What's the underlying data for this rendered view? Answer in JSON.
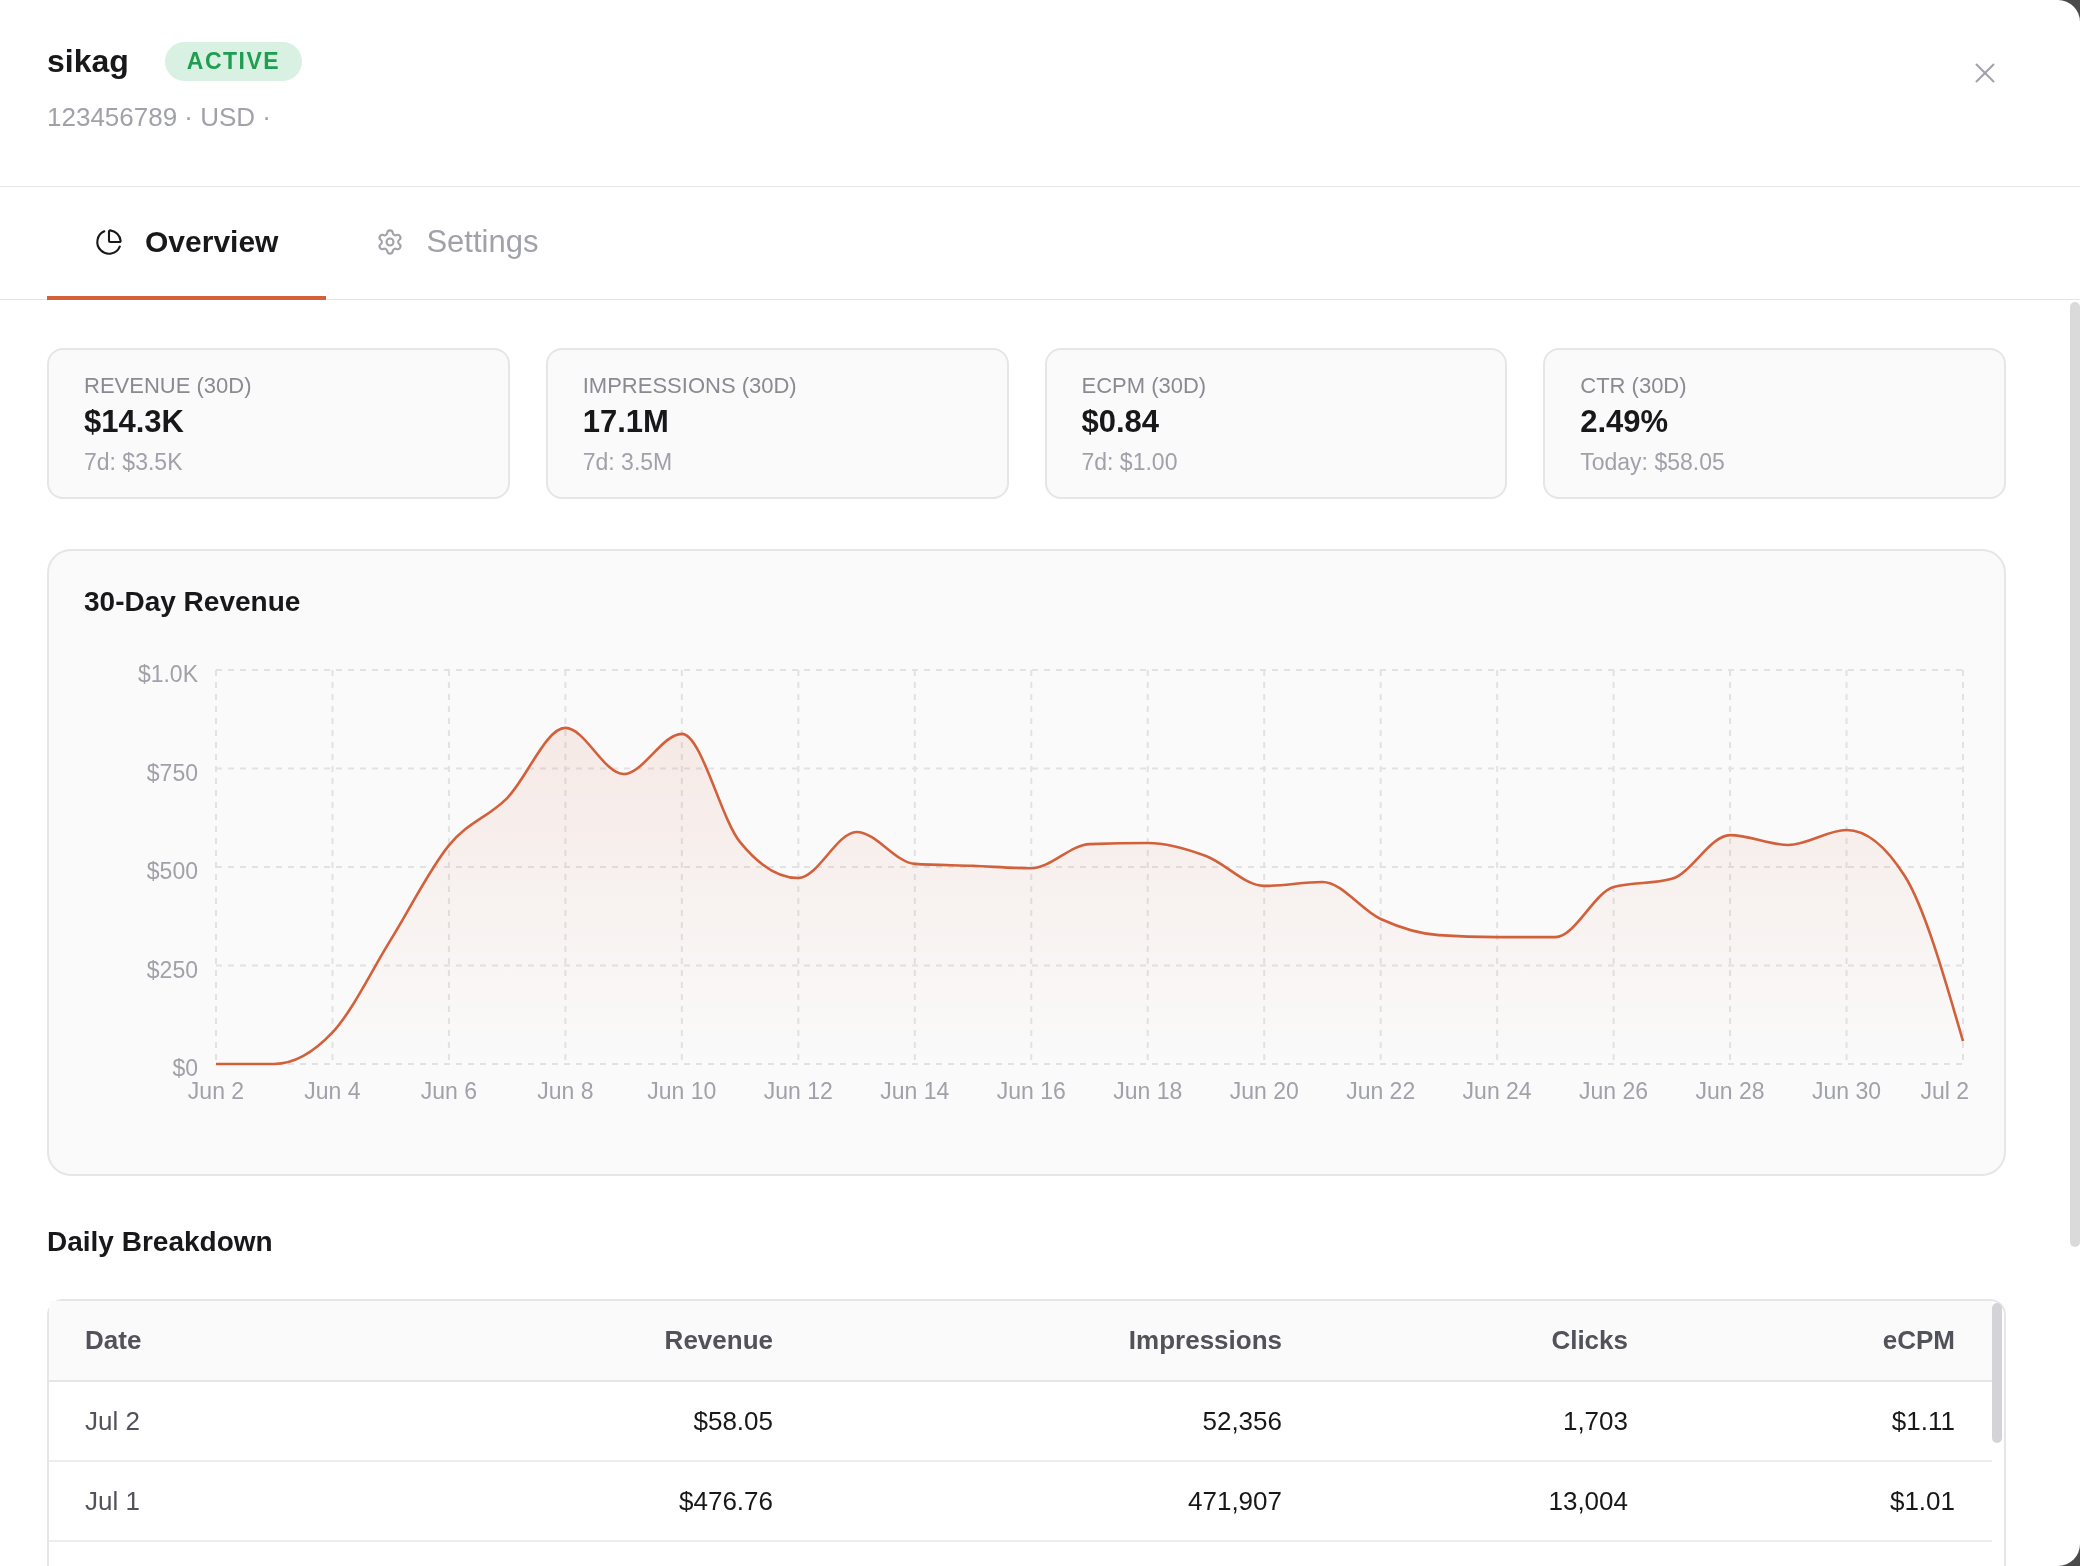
{
  "account": {
    "name": "sikag",
    "status": {
      "label": "ACTIVE",
      "active": true
    },
    "meta": "123456789 · USD ·"
  },
  "tabs": [
    {
      "label": "Overview",
      "selected": true
    },
    {
      "label": "Settings",
      "selected": false
    }
  ],
  "stats": [
    {
      "label": "REVENUE (30D)",
      "value": "$14.3K",
      "note": "7d: $3.5K"
    },
    {
      "label": "IMPRESSIONS (30D)",
      "value": "17.1M",
      "note": "7d: 3.5M"
    },
    {
      "label": "ECPM (30D)",
      "value": "$0.84",
      "note": "7d: $1.00"
    },
    {
      "label": "CTR (30D)",
      "value": "2.49%",
      "note": "Today: $58.05"
    }
  ],
  "revenue_chart": {
    "chart_data": {
      "type": "area",
      "title": "30-Day Revenue",
      "categories": [
        "Jun 2",
        null,
        "Jun 4",
        null,
        "Jun 6",
        null,
        "Jun 8",
        null,
        "Jun 10",
        null,
        "Jun 12",
        null,
        "Jun 14",
        null,
        "Jun 16",
        null,
        "Jun 18",
        null,
        "Jun 20",
        null,
        "Jun 22",
        null,
        "Jun 24",
        null,
        "Jun 26",
        null,
        "Jun 28",
        null,
        "Jun 30",
        null,
        "Jul 2"
      ],
      "series": [
        {
          "color": "#d2603a",
          "values": [
            0,
            0,
            80,
            315,
            555,
            675,
            853,
            736,
            838,
            563,
            472,
            589,
            508,
            503,
            497,
            558,
            561,
            528,
            452,
            462,
            368,
            327,
            322,
            322,
            449,
            470,
            581,
            556,
            594,
            477,
            58
          ]
        }
      ],
      "ylim": [
        0,
        1000
      ],
      "yticks": [
        {
          "value": 0,
          "label": "$0"
        },
        {
          "value": 250,
          "label": "$250"
        },
        {
          "value": 500,
          "label": "$500"
        },
        {
          "value": 750,
          "label": "$750"
        },
        {
          "value": 1000,
          "label": "$1.0K"
        }
      ],
      "grid": true
    }
  },
  "daily_breakdown": {
    "title": "Daily Breakdown",
    "columns": [
      "Date",
      "Revenue",
      "Impressions",
      "Clicks",
      "eCPM"
    ],
    "rows": [
      [
        "Jul 2",
        "$58.05",
        "52,356",
        "1,703",
        "$1.11"
      ],
      [
        "Jul 1",
        "$476.76",
        "471,907",
        "13,004",
        "$1.01"
      ]
    ]
  }
}
